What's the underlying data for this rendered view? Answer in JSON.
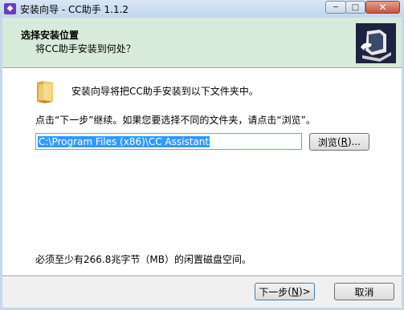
{
  "window": {
    "title": "安装向导 - CC助手 1.1.2",
    "min_label": "─",
    "max_label": "□",
    "close_label": "✕"
  },
  "header": {
    "title": "选择安装位置",
    "subtitle": "将CC助手安装到何处？"
  },
  "body": {
    "intro": "安装向导将把CC助手安装到以下文件夹中。",
    "instruction": "点击“下一步”继续。如果您要选择不同的文件夹，请点击“浏览”。",
    "path_value": "C:\\Program Files (x86)\\CC Assistant",
    "browse_label": "浏览",
    "browse_key": "R",
    "space_text": "必须至少有266.8兆字节（MB）的闲置磁盘空间。"
  },
  "footer": {
    "next_label": "下一步",
    "next_key": "N",
    "next_arrow": " >",
    "cancel_label": "取消"
  },
  "colors": {
    "header_bg": "#d8ebda",
    "selection": "#3399ff"
  }
}
